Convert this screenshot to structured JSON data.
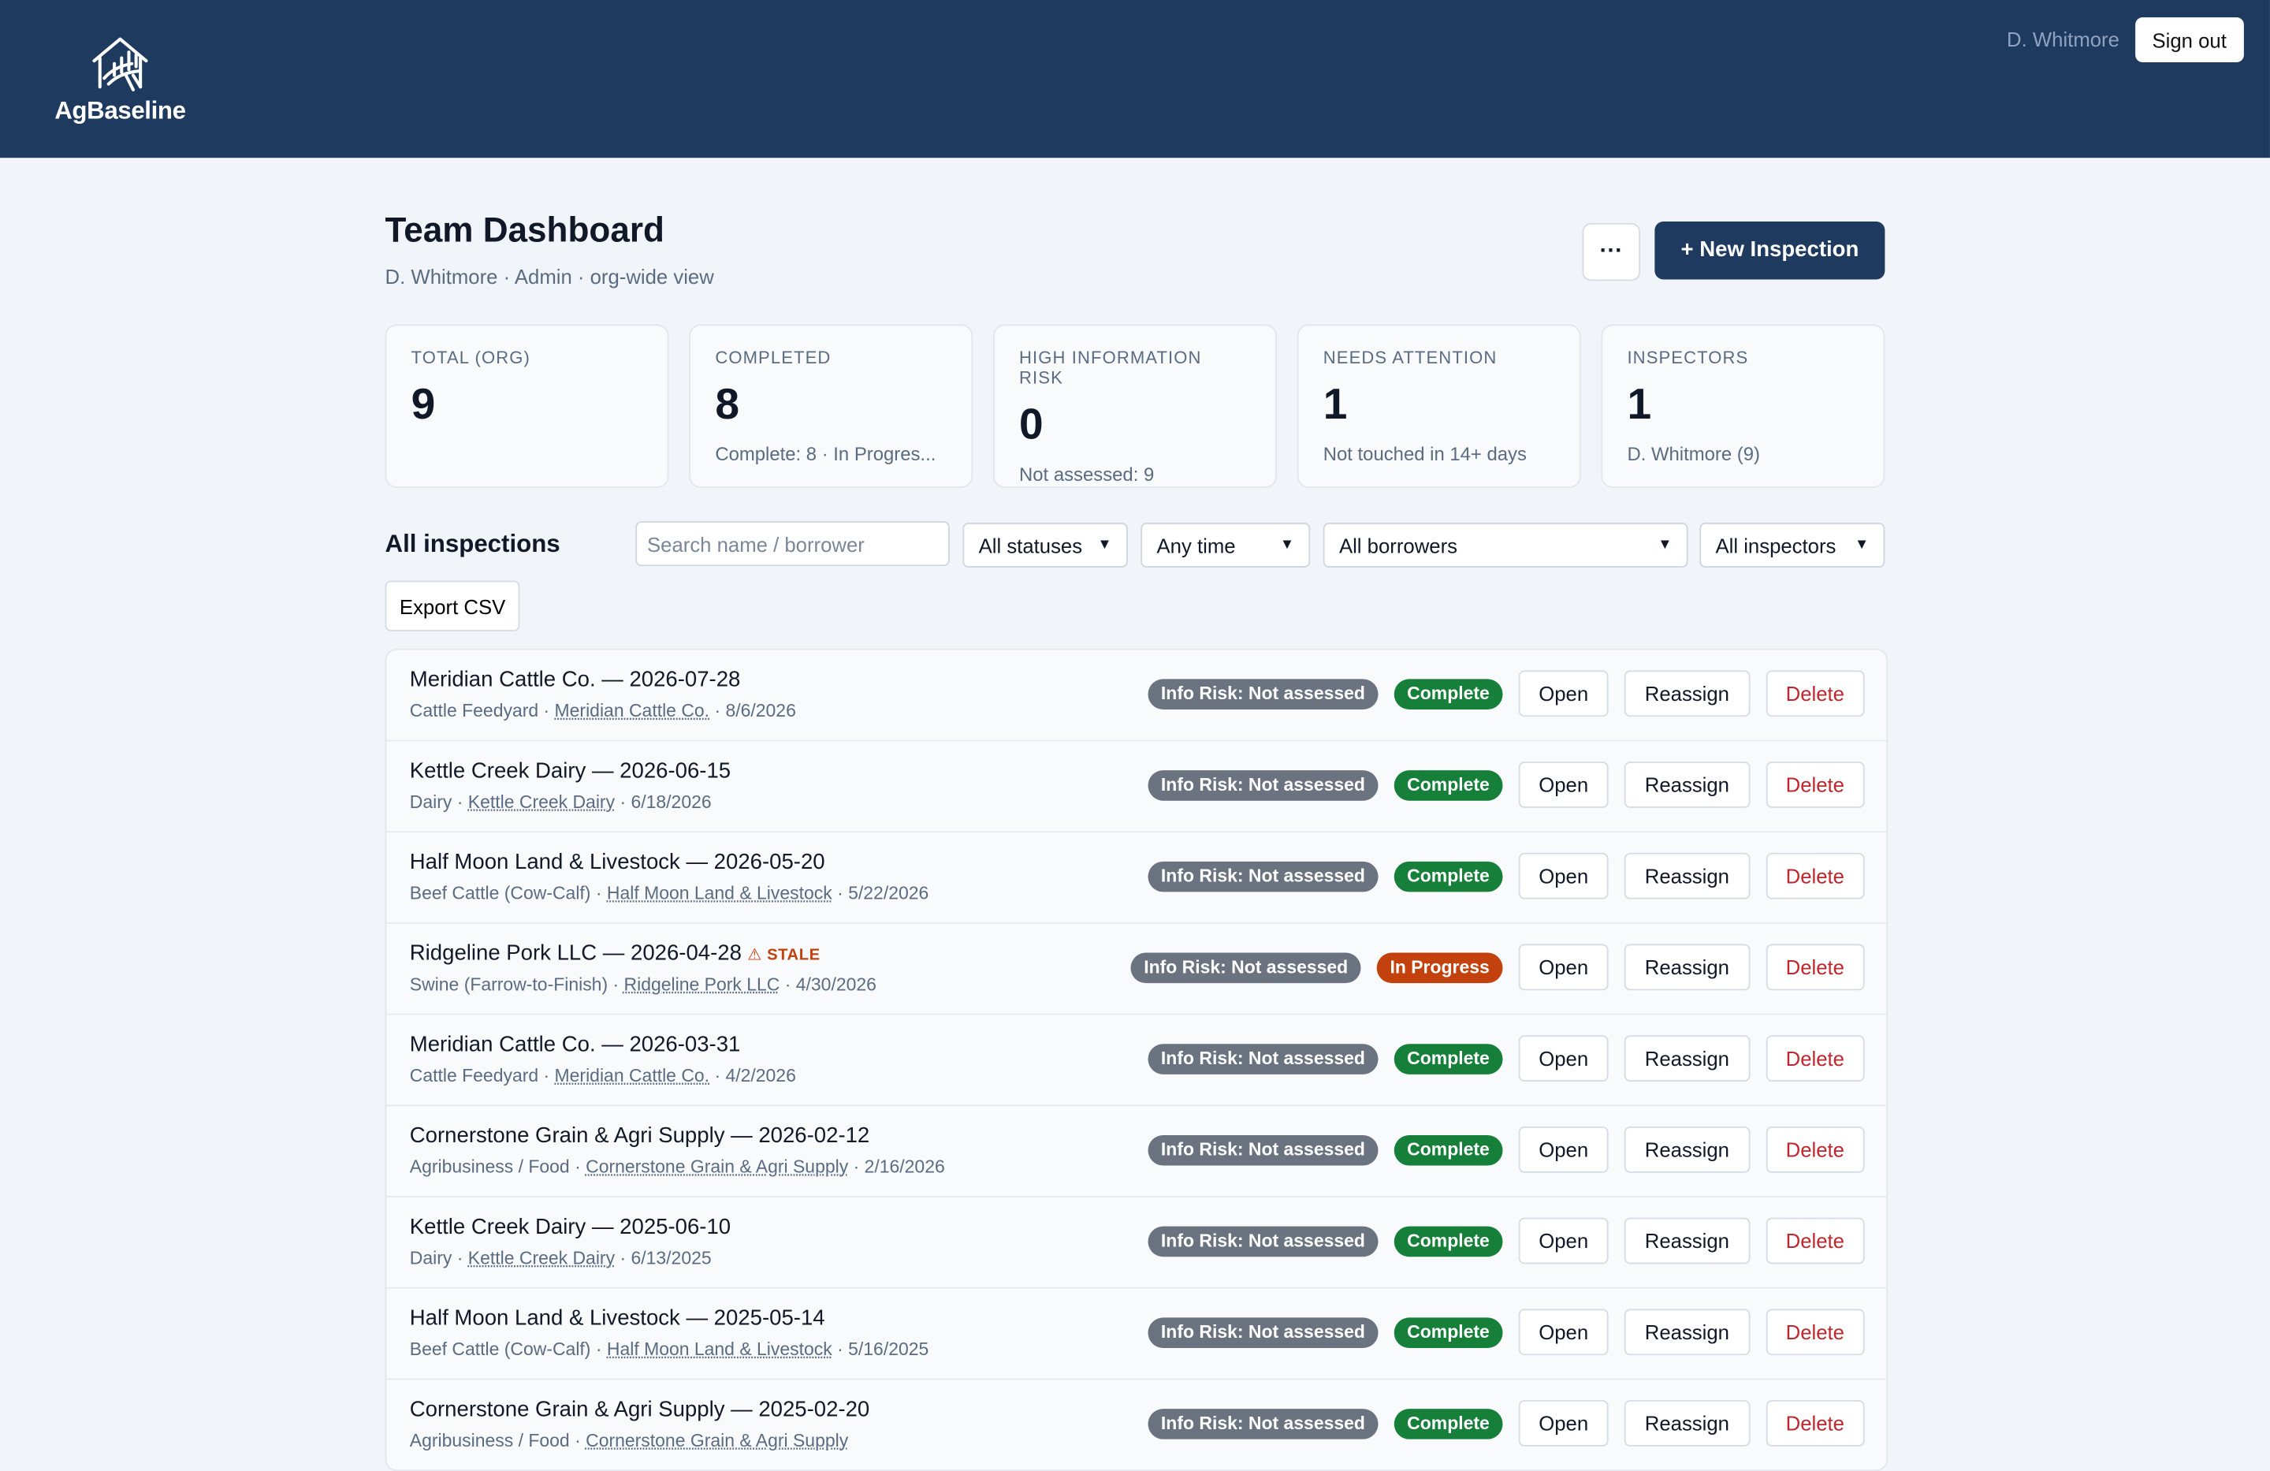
{
  "app": {
    "name": "AgBaseline"
  },
  "header": {
    "user_name": "D. Whitmore",
    "sign_out": "Sign out"
  },
  "page": {
    "title": "Team Dashboard",
    "subtitle": "D. Whitmore · Admin · org-wide view",
    "more_label": "···",
    "new_inspection": "+ New Inspection"
  },
  "stats": [
    {
      "label": "TOTAL (ORG)",
      "value": "9",
      "sub": ""
    },
    {
      "label": "COMPLETED",
      "value": "8",
      "sub": "Complete: 8 · In Progres..."
    },
    {
      "label": "HIGH INFORMATION RISK",
      "value": "0",
      "sub": "Not assessed: 9"
    },
    {
      "label": "NEEDS ATTENTION",
      "value": "1",
      "sub": "Not touched in 14+ days"
    },
    {
      "label": "INSPECTORS",
      "value": "1",
      "sub": "D. Whitmore (9)"
    }
  ],
  "filters": {
    "section_title": "All inspections",
    "search_placeholder": "Search name / borrower",
    "status": "All statuses",
    "time": "Any time",
    "borrower": "All borrowers",
    "inspector": "All inspectors",
    "export": "Export CSV"
  },
  "actions": {
    "open": "Open",
    "reassign": "Reassign",
    "delete": "Delete"
  },
  "inspections": [
    {
      "title": "Meridian Cattle Co. — 2026-07-28",
      "stale": "",
      "type": "Cattle Feedyard",
      "borrower": "Meridian Cattle Co.",
      "date": "8/6/2026",
      "risk": "Info Risk: Not assessed",
      "status": "Complete"
    },
    {
      "title": "Kettle Creek Dairy — 2026-06-15",
      "stale": "",
      "type": "Dairy",
      "borrower": "Kettle Creek Dairy",
      "date": "6/18/2026",
      "risk": "Info Risk: Not assessed",
      "status": "Complete"
    },
    {
      "title": "Half Moon Land & Livestock — 2026-05-20",
      "stale": "",
      "type": "Beef Cattle (Cow-Calf)",
      "borrower": "Half Moon Land & Livestock",
      "date": "5/22/2026",
      "risk": "Info Risk: Not assessed",
      "status": "Complete"
    },
    {
      "title": "Ridgeline Pork LLC — 2026-04-28",
      "stale": "⚠ STALE",
      "type": "Swine (Farrow-to-Finish)",
      "borrower": "Ridgeline Pork LLC",
      "date": "4/30/2026",
      "risk": "Info Risk: Not assessed",
      "status": "In Progress"
    },
    {
      "title": "Meridian Cattle Co. — 2026-03-31",
      "stale": "",
      "type": "Cattle Feedyard",
      "borrower": "Meridian Cattle Co.",
      "date": "4/2/2026",
      "risk": "Info Risk: Not assessed",
      "status": "Complete"
    },
    {
      "title": "Cornerstone Grain & Agri Supply — 2026-02-12",
      "stale": "",
      "type": "Agribusiness / Food",
      "borrower": "Cornerstone Grain & Agri Supply",
      "date": "2/16/2026",
      "risk": "Info Risk: Not assessed",
      "status": "Complete"
    },
    {
      "title": "Kettle Creek Dairy — 2025-06-10",
      "stale": "",
      "type": "Dairy",
      "borrower": "Kettle Creek Dairy",
      "date": "6/13/2025",
      "risk": "Info Risk: Not assessed",
      "status": "Complete"
    },
    {
      "title": "Half Moon Land & Livestock — 2025-05-14",
      "stale": "",
      "type": "Beef Cattle (Cow-Calf)",
      "borrower": "Half Moon Land & Livestock",
      "date": "5/16/2025",
      "risk": "Info Risk: Not assessed",
      "status": "Complete"
    },
    {
      "title": "Cornerstone Grain & Agri Supply — 2025-02-20",
      "stale": "",
      "type": "Agribusiness / Food",
      "borrower": "Cornerstone Grain & Agri Supply",
      "date": "",
      "risk": "Info Risk: Not assessed",
      "status": "Complete"
    }
  ],
  "colors": {
    "header_bg": "#1e3a5f",
    "complete": "#16803a",
    "in_progress": "#c2410c",
    "risk": "#6b7280",
    "delete": "#c0262d"
  }
}
